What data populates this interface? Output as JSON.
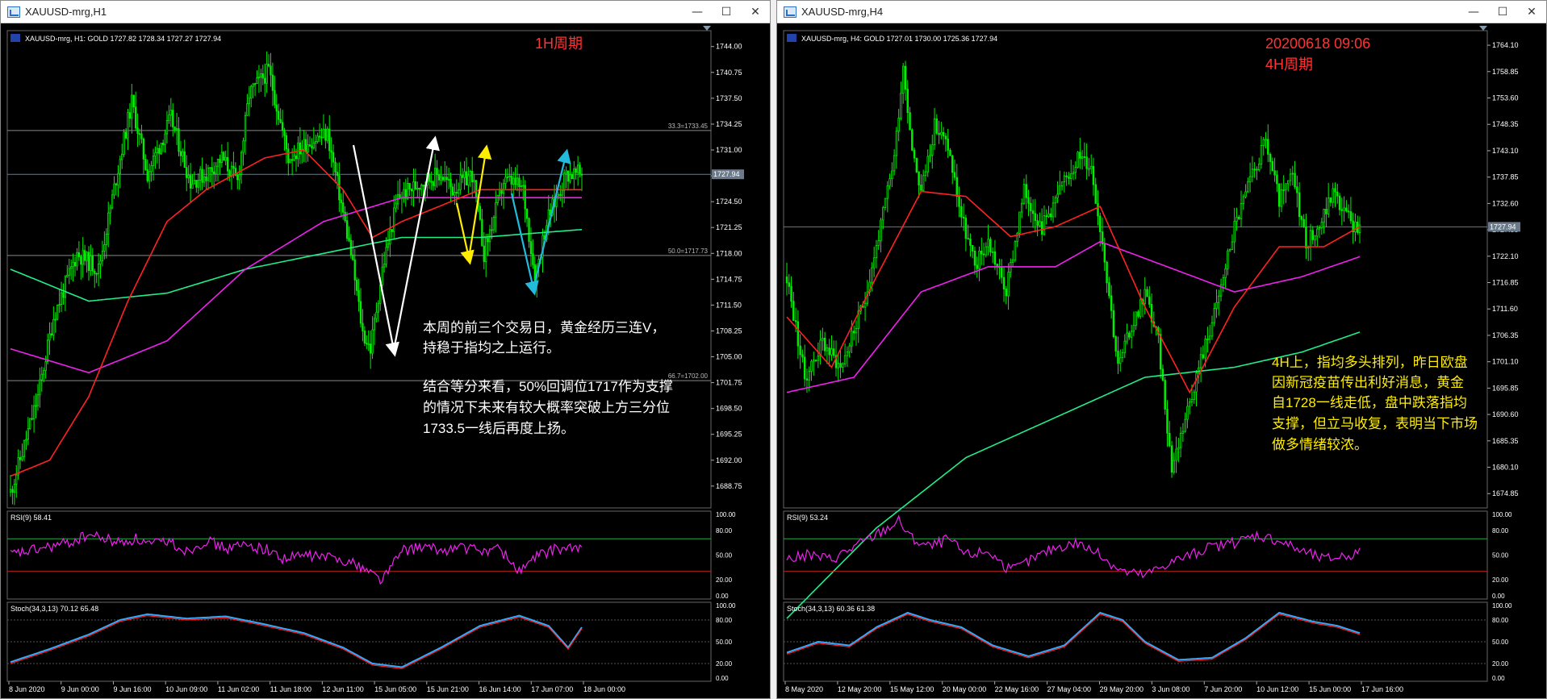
{
  "colors": {
    "candle": "#00ee00",
    "ma_fast": "#ff2222",
    "ma_mid": "#ee22ee",
    "ma_slow": "#22ee88",
    "rsi": "#ee22ee",
    "stoch_main": "#33aaff",
    "stoch_signal": "#ff2222",
    "grid_text": "#ffffff",
    "level_line": "#888888",
    "annot_white": "#ffffff",
    "annot_yellow": "#ffee00",
    "annot_cyan": "#22bbdd",
    "title_red": "#ff3333"
  },
  "windows": [
    {
      "id": "h1",
      "title": "XAUUSD-mrg,H1",
      "buttons": {
        "minimize": "—",
        "maximize": "☐",
        "close": "✕"
      },
      "info_line": "XAUUSD-mrg, H1:  GOLD   1727.82  1728.34  1727.27  1727.94",
      "period_label": "1H周期",
      "date_label": "",
      "current_price": "1727.94",
      "price_ticks": [
        "1744.00",
        "1740.75",
        "1737.50",
        "1734.25",
        "1731.00",
        "1727.75",
        "1724.50",
        "1721.25",
        "1718.00",
        "1714.75",
        "1711.50",
        "1708.25",
        "1705.00",
        "1701.75",
        "1698.50",
        "1695.25",
        "1692.00",
        "1688.75"
      ],
      "fib_levels": [
        {
          "label": "33.3=1733.45",
          "price": 1733.45
        },
        {
          "label": "50.0=1717.73",
          "price": 1717.73
        },
        {
          "label": "66.7=1702.00",
          "price": 1702.0
        }
      ],
      "rsi_label": "RSI(9) 58.41",
      "rsi_ticks": [
        "100.00",
        "80.00",
        "50.00",
        "20.00",
        "0.00"
      ],
      "stoch_label": "Stoch(34,3,13) 70.12 65.48",
      "stoch_ticks": [
        "100.00",
        "80.00",
        "50.00",
        "20.00",
        "0.00"
      ],
      "time_ticks": [
        "8 Jun 2020",
        "9 Jun 00:00",
        "9 Jun 16:00",
        "10 Jun 09:00",
        "11 Jun 02:00",
        "11 Jun 18:00",
        "12 Jun 11:00",
        "15 Jun 05:00",
        "15 Jun 21:00",
        "16 Jun 14:00",
        "17 Jun 07:00",
        "18 Jun 00:00"
      ],
      "notes": [
        "本周的前三个交易日，黄金经历三连V，",
        "持稳于指均之上运行。",
        "结合等分来看，50%回调位1717作为支撑",
        "的情况下未来有较大概率突破上方三分位",
        "1733.5一线后再度上扬。"
      ]
    },
    {
      "id": "h4",
      "title": "XAUUSD-mrg,H4",
      "buttons": {
        "minimize": "—",
        "maximize": "☐",
        "close": "✕"
      },
      "info_line": "XAUUSD-mrg, H4:  GOLD   1727.01  1730.00  1725.36  1727.94",
      "period_label": "4H周期",
      "date_label": "20200618 09:06",
      "current_price": "1727.94",
      "price_ticks": [
        "1764.10",
        "1758.85",
        "1753.60",
        "1748.35",
        "1743.10",
        "1737.85",
        "1732.60",
        "1727.35",
        "1722.10",
        "1716.85",
        "1711.60",
        "1706.35",
        "1701.10",
        "1695.85",
        "1690.60",
        "1685.35",
        "1680.10",
        "1674.85"
      ],
      "fib_levels": [],
      "rsi_label": "RSI(9) 53.24",
      "rsi_ticks": [
        "100.00",
        "80.00",
        "50.00",
        "20.00",
        "0.00"
      ],
      "stoch_label": "Stoch(34,3,13) 60.36 61.38",
      "stoch_ticks": [
        "100.00",
        "80.00",
        "50.00",
        "20.00",
        "0.00"
      ],
      "time_ticks": [
        "8 May 2020",
        "12 May 20:00",
        "15 May 12:00",
        "20 May 00:00",
        "22 May 16:00",
        "27 May 04:00",
        "29 May 20:00",
        "3 Jun 08:00",
        "7 Jun 20:00",
        "10 Jun 12:00",
        "15 Jun 00:00",
        "17 Jun 16:00"
      ],
      "notes": [
        "4H上，指均多头排列，昨日欧盘",
        "因新冠疫苗传出利好消息，黄金",
        "自1728一线走低，盘中跌落指均",
        "支撑，但立马收复，表明当下市场",
        "做多情绪较浓。"
      ]
    }
  ],
  "chart_data": [
    {
      "type": "candlestick",
      "title": "XAUUSD-mrg,H1",
      "ylim": [
        1686,
        1746
      ],
      "anchors": [
        [
          0,
          1688
        ],
        [
          6,
          1693
        ],
        [
          14,
          1700
        ],
        [
          22,
          1710
        ],
        [
          34,
          1718
        ],
        [
          45,
          1716
        ],
        [
          56,
          1730
        ],
        [
          62,
          1737
        ],
        [
          70,
          1728
        ],
        [
          82,
          1735
        ],
        [
          92,
          1727
        ],
        [
          100,
          1728
        ],
        [
          108,
          1730
        ],
        [
          116,
          1727
        ],
        [
          122,
          1738
        ],
        [
          132,
          1741
        ],
        [
          142,
          1730
        ],
        [
          152,
          1732
        ],
        [
          162,
          1733
        ],
        [
          174,
          1718
        ],
        [
          180,
          1708
        ],
        [
          184,
          1706
        ],
        [
          190,
          1716
        ],
        [
          198,
          1725
        ],
        [
          210,
          1727
        ],
        [
          220,
          1728
        ],
        [
          226,
          1726
        ],
        [
          236,
          1728
        ],
        [
          242,
          1718
        ],
        [
          252,
          1727
        ],
        [
          256,
          1727
        ],
        [
          262,
          1726
        ],
        [
          268,
          1715
        ],
        [
          274,
          1722
        ],
        [
          284,
          1728
        ],
        [
          292,
          1728
        ]
      ],
      "ma_fast": [
        [
          0,
          1690
        ],
        [
          20,
          1692
        ],
        [
          40,
          1700
        ],
        [
          60,
          1712
        ],
        [
          80,
          1722
        ],
        [
          100,
          1726
        ],
        [
          130,
          1730
        ],
        [
          150,
          1731
        ],
        [
          170,
          1726
        ],
        [
          185,
          1720
        ],
        [
          200,
          1722
        ],
        [
          240,
          1726
        ],
        [
          292,
          1726
        ]
      ],
      "ma_mid": [
        [
          0,
          1706
        ],
        [
          40,
          1703
        ],
        [
          80,
          1707
        ],
        [
          120,
          1716
        ],
        [
          160,
          1722
        ],
        [
          200,
          1725
        ],
        [
          240,
          1725
        ],
        [
          292,
          1725
        ]
      ],
      "ma_slow": [
        [
          0,
          1716
        ],
        [
          40,
          1712
        ],
        [
          80,
          1713
        ],
        [
          120,
          1716
        ],
        [
          160,
          1718
        ],
        [
          200,
          1720
        ],
        [
          240,
          1720
        ],
        [
          292,
          1721
        ]
      ],
      "rsi": [
        [
          0,
          50
        ],
        [
          10,
          55
        ],
        [
          20,
          60
        ],
        [
          30,
          65
        ],
        [
          40,
          75
        ],
        [
          48,
          70
        ],
        [
          56,
          65
        ],
        [
          64,
          70
        ],
        [
          72,
          62
        ],
        [
          80,
          68
        ],
        [
          90,
          55
        ],
        [
          100,
          68
        ],
        [
          110,
          58
        ],
        [
          120,
          62
        ],
        [
          130,
          58
        ],
        [
          140,
          45
        ],
        [
          150,
          50
        ],
        [
          160,
          48
        ],
        [
          170,
          45
        ],
        [
          180,
          35
        ],
        [
          190,
          20
        ],
        [
          200,
          55
        ],
        [
          210,
          60
        ],
        [
          220,
          55
        ],
        [
          230,
          60
        ],
        [
          240,
          55
        ],
        [
          250,
          58
        ],
        [
          260,
          30
        ],
        [
          270,
          50
        ],
        [
          280,
          58
        ],
        [
          292,
          58
        ]
      ],
      "stoch": [
        [
          0,
          22
        ],
        [
          20,
          40
        ],
        [
          40,
          60
        ],
        [
          56,
          80
        ],
        [
          70,
          88
        ],
        [
          90,
          82
        ],
        [
          110,
          85
        ],
        [
          130,
          74
        ],
        [
          150,
          62
        ],
        [
          170,
          42
        ],
        [
          185,
          20
        ],
        [
          200,
          15
        ],
        [
          220,
          42
        ],
        [
          240,
          72
        ],
        [
          260,
          86
        ],
        [
          275,
          72
        ],
        [
          285,
          42
        ],
        [
          292,
          70
        ]
      ]
    },
    {
      "type": "candlestick",
      "title": "XAUUSD-mrg,H4",
      "ylim": [
        1672,
        1767
      ],
      "anchors": [
        [
          0,
          1718
        ],
        [
          8,
          1698
        ],
        [
          16,
          1705
        ],
        [
          24,
          1700
        ],
        [
          34,
          1712
        ],
        [
          42,
          1728
        ],
        [
          48,
          1742
        ],
        [
          52,
          1760
        ],
        [
          56,
          1744
        ],
        [
          60,
          1735
        ],
        [
          66,
          1748
        ],
        [
          72,
          1744
        ],
        [
          78,
          1730
        ],
        [
          84,
          1720
        ],
        [
          90,
          1725
        ],
        [
          98,
          1715
        ],
        [
          106,
          1735
        ],
        [
          114,
          1728
        ],
        [
          122,
          1735
        ],
        [
          130,
          1742
        ],
        [
          136,
          1740
        ],
        [
          142,
          1722
        ],
        [
          148,
          1700
        ],
        [
          154,
          1708
        ],
        [
          160,
          1715
        ],
        [
          166,
          1705
        ],
        [
          172,
          1680
        ],
        [
          178,
          1690
        ],
        [
          184,
          1700
        ],
        [
          192,
          1712
        ],
        [
          200,
          1728
        ],
        [
          208,
          1738
        ],
        [
          214,
          1745
        ],
        [
          220,
          1733
        ],
        [
          226,
          1738
        ],
        [
          232,
          1725
        ],
        [
          238,
          1728
        ],
        [
          244,
          1735
        ],
        [
          250,
          1730
        ],
        [
          256,
          1727
        ]
      ],
      "ma_fast": [
        [
          0,
          1710
        ],
        [
          20,
          1700
        ],
        [
          40,
          1718
        ],
        [
          60,
          1735
        ],
        [
          80,
          1734
        ],
        [
          100,
          1726
        ],
        [
          120,
          1728
        ],
        [
          140,
          1732
        ],
        [
          160,
          1712
        ],
        [
          180,
          1695
        ],
        [
          200,
          1712
        ],
        [
          220,
          1724
        ],
        [
          240,
          1724
        ],
        [
          256,
          1728
        ]
      ],
      "ma_mid": [
        [
          0,
          1695
        ],
        [
          30,
          1698
        ],
        [
          60,
          1715
        ],
        [
          90,
          1720
        ],
        [
          120,
          1720
        ],
        [
          140,
          1725
        ],
        [
          170,
          1720
        ],
        [
          200,
          1715
        ],
        [
          230,
          1718
        ],
        [
          256,
          1722
        ]
      ],
      "ma_slow": [
        [
          0,
          1650
        ],
        [
          40,
          1668
        ],
        [
          80,
          1682
        ],
        [
          120,
          1690
        ],
        [
          160,
          1698
        ],
        [
          200,
          1700
        ],
        [
          230,
          1703
        ],
        [
          256,
          1707
        ]
      ],
      "rsi": [
        [
          0,
          45
        ],
        [
          10,
          50
        ],
        [
          20,
          45
        ],
        [
          30,
          60
        ],
        [
          40,
          75
        ],
        [
          50,
          92
        ],
        [
          56,
          70
        ],
        [
          64,
          60
        ],
        [
          72,
          70
        ],
        [
          80,
          50
        ],
        [
          90,
          55
        ],
        [
          100,
          30
        ],
        [
          110,
          45
        ],
        [
          120,
          60
        ],
        [
          130,
          65
        ],
        [
          140,
          50
        ],
        [
          150,
          30
        ],
        [
          160,
          25
        ],
        [
          170,
          40
        ],
        [
          180,
          50
        ],
        [
          190,
          60
        ],
        [
          200,
          65
        ],
        [
          210,
          75
        ],
        [
          220,
          68
        ],
        [
          230,
          55
        ],
        [
          240,
          45
        ],
        [
          256,
          53
        ]
      ],
      "stoch": [
        [
          0,
          35
        ],
        [
          14,
          50
        ],
        [
          28,
          45
        ],
        [
          40,
          70
        ],
        [
          54,
          90
        ],
        [
          64,
          80
        ],
        [
          78,
          70
        ],
        [
          92,
          45
        ],
        [
          108,
          30
        ],
        [
          124,
          45
        ],
        [
          140,
          90
        ],
        [
          150,
          80
        ],
        [
          160,
          50
        ],
        [
          175,
          25
        ],
        [
          190,
          28
        ],
        [
          205,
          55
        ],
        [
          220,
          90
        ],
        [
          235,
          78
        ],
        [
          246,
          72
        ],
        [
          256,
          62
        ]
      ]
    }
  ]
}
